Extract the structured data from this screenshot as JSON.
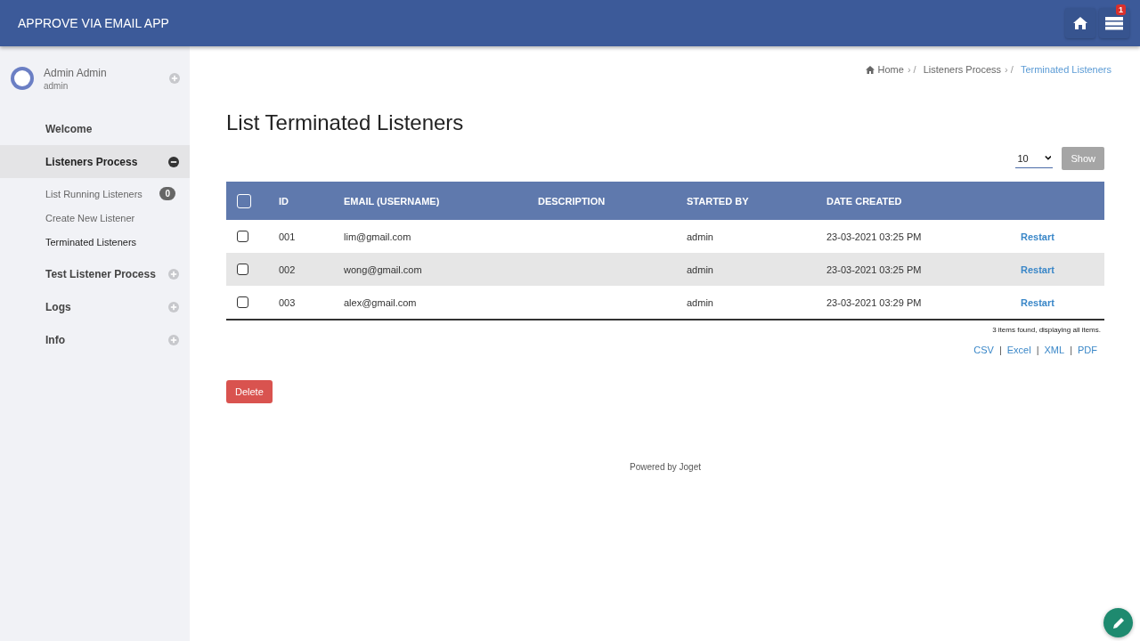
{
  "header": {
    "title": "APPROVE VIA EMAIL APP",
    "notification_count": "1"
  },
  "sidebar": {
    "user": {
      "name": "Admin Admin",
      "username": "admin",
      "expanded": false
    },
    "items": [
      {
        "label": "Welcome",
        "kind": "link",
        "selected": false
      },
      {
        "label": "Listeners Process",
        "kind": "group",
        "expanded": true,
        "selected": true,
        "children": [
          {
            "label": "List Running Listeners",
            "badge": "0",
            "selected": false
          },
          {
            "label": "Create New Listener",
            "selected": false
          },
          {
            "label": "Terminated Listeners",
            "selected": true
          }
        ]
      },
      {
        "label": "Test Listener Process",
        "kind": "group",
        "expanded": false,
        "selected": false
      },
      {
        "label": "Logs",
        "kind": "group",
        "expanded": false,
        "selected": false
      },
      {
        "label": "Info",
        "kind": "group",
        "expanded": false,
        "selected": false
      }
    ]
  },
  "breadcrumb": [
    {
      "label": "Home",
      "trail": "› /",
      "current": false
    },
    {
      "label": "Listeners Process",
      "trail": "› /",
      "current": false
    },
    {
      "label": "Terminated Listeners",
      "current": true
    }
  ],
  "page_title": "List Terminated Listeners",
  "page_size": {
    "value": "10",
    "button": "Show"
  },
  "table": {
    "select_all_checked": false,
    "columns": [
      "ID",
      "EMAIL (USERNAME)",
      "DESCRIPTION",
      "STARTED BY",
      "DATE CREATED"
    ],
    "rows": [
      {
        "checked": false,
        "id": "001",
        "email": "lim@gmail.com",
        "started_by": "admin",
        "date_created": "23-03-2021 03:25 PM",
        "action": "Restart"
      },
      {
        "checked": false,
        "id": "002",
        "email": "wong@gmail.com",
        "started_by": "admin",
        "date_created": "23-03-2021 03:25 PM",
        "action": "Restart"
      },
      {
        "checked": false,
        "id": "003",
        "email": "alex@gmail.com",
        "started_by": "admin",
        "date_created": "23-03-2021 03:29 PM",
        "action": "Restart"
      }
    ]
  },
  "summary": "3 items found, displaying all items.",
  "exports": {
    "separator": "|",
    "formats": [
      "CSV",
      "Excel",
      "XML",
      "PDF"
    ]
  },
  "delete_button": "Delete",
  "footer": "Powered by Joget"
}
